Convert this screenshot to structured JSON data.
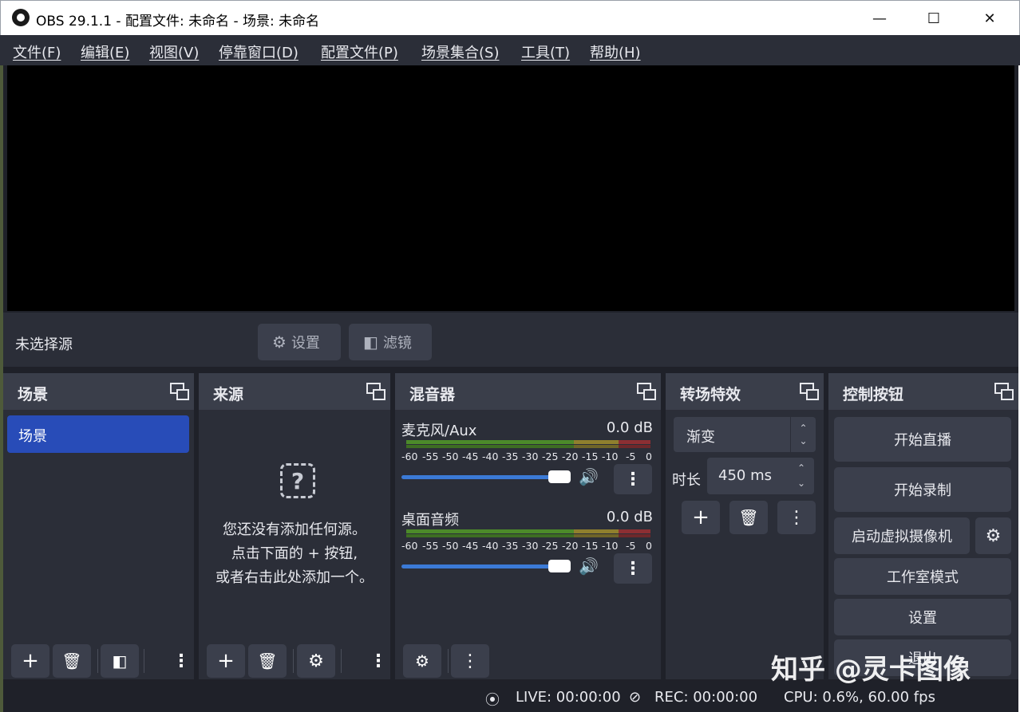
{
  "window": {
    "title": "OBS 29.1.1 - 配置文件: 未命名 - 场景: 未命名"
  },
  "menu": [
    "文件(F)",
    "编辑(E)",
    "视图(V)",
    "停靠窗口(D)",
    "配置文件(P)",
    "场景集合(S)",
    "工具(T)",
    "帮助(H)"
  ],
  "context_bar": {
    "no_source": "未选择源",
    "settings_label": "设置",
    "filters_label": "滤镜"
  },
  "scenes": {
    "title": "场景",
    "items": [
      "场景"
    ]
  },
  "sources": {
    "title": "来源",
    "empty_lines": [
      "您还没有添加任何源。",
      "点击下面的 + 按钮,",
      "或者右击此处添加一个。"
    ]
  },
  "mixer": {
    "title": "混音器",
    "channels": [
      {
        "name": "麦克风/Aux",
        "db": "0.0 dB",
        "volume": 0.9
      },
      {
        "name": "桌面音频",
        "db": "0.0 dB",
        "volume": 0.9
      }
    ],
    "ticks": [
      "-60",
      "-55",
      "-50",
      "-45",
      "-40",
      "-35",
      "-30",
      "-25",
      "-20",
      "-15",
      "-10",
      "-5",
      "0"
    ]
  },
  "transitions": {
    "title": "转场特效",
    "selected": "渐变",
    "duration_label": "时长",
    "duration_value": "450 ms"
  },
  "controls": {
    "title": "控制按钮",
    "start_stream": "开始直播",
    "start_record": "开始录制",
    "start_virtualcam": "启动虚拟摄像机",
    "studio_mode": "工作室模式",
    "settings": "设置",
    "exit": "退出"
  },
  "status": {
    "live": "LIVE: 00:00:00",
    "rec": "REC: 00:00:00",
    "cpu": "CPU: 0.6%, 60.00 fps"
  },
  "watermark": "知乎 @灵卡图像"
}
